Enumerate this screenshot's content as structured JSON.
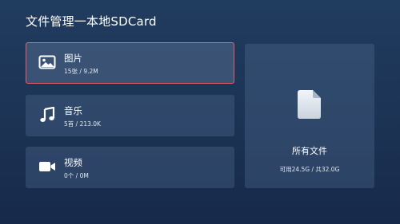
{
  "header": {
    "title": "文件管理一本地SDCard"
  },
  "categories": [
    {
      "label": "图片",
      "meta": "15张 / 9.2M",
      "icon": "image-icon"
    },
    {
      "label": "音乐",
      "meta": "5首 / 213.0K",
      "icon": "music-note-icon"
    },
    {
      "label": "视频",
      "meta": "0个 / 0M",
      "icon": "video-camera-icon"
    }
  ],
  "all_files": {
    "label": "所有文件",
    "meta": "可用24.5G / 共32.0G",
    "icon": "document-icon"
  },
  "colors": {
    "focus_border": "#e2616a",
    "background_top": "#203c5f",
    "background_bottom": "#17294a"
  }
}
